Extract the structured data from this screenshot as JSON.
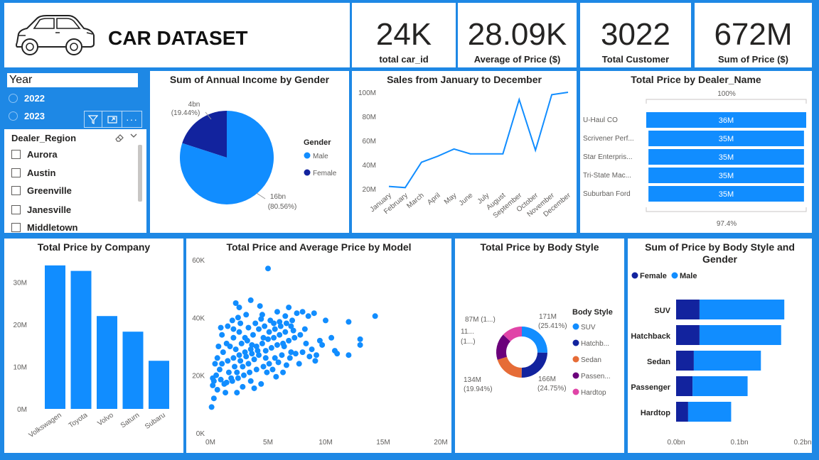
{
  "header": {
    "title": "CAR DATASET"
  },
  "kpis": [
    {
      "value": "24K",
      "label": "total car_id"
    },
    {
      "value": "28.09K",
      "label": "Average of Price ($)"
    },
    {
      "value": "3022",
      "label": "Total Customer"
    },
    {
      "value": "672M",
      "label": "Sum of Price ($)"
    }
  ],
  "year_slicer": {
    "title": "Year",
    "options": [
      "2022",
      "2023"
    ],
    "icons": [
      "filter-icon",
      "focus-mode-icon",
      "more-options-icon"
    ]
  },
  "region_slicer": {
    "title": "Dealer_Region",
    "options": [
      "Aurora",
      "Austin",
      "Greenville",
      "Janesville",
      "Middletown"
    ]
  },
  "colors": {
    "accent": "#118DFF",
    "dark": "#12239E",
    "orange": "#E66C37",
    "purple": "#6B007B",
    "pink": "#E044A7",
    "background": "#1E88E5"
  },
  "chart_data": [
    {
      "id": "gender_pie",
      "type": "pie",
      "title": "Sum of Annual Income by Gender",
      "legend_title": "Gender",
      "legend_position": "right",
      "slices": [
        {
          "name": "Male",
          "value": 16,
          "label": "16bn",
          "percent": "(80.56%)",
          "color": "#118DFF"
        },
        {
          "name": "Female",
          "value": 4,
          "label": "4bn",
          "percent": "(19.44%)",
          "color": "#12239E"
        }
      ]
    },
    {
      "id": "sales_line",
      "type": "line",
      "title": "Sales from January to December",
      "categories": [
        "January",
        "February",
        "March",
        "April",
        "May",
        "June",
        "July",
        "August",
        "September",
        "October",
        "November",
        "December"
      ],
      "values": [
        22,
        21,
        42,
        47,
        53,
        49,
        49,
        49,
        94,
        52,
        98,
        100
      ],
      "yticks": [
        "20M",
        "40M",
        "60M",
        "80M",
        "100M"
      ],
      "ylim": [
        20,
        100
      ]
    },
    {
      "id": "dealer_bar",
      "type": "bar",
      "orientation": "horizontal",
      "title": "Total Price by Dealer_Name",
      "top_label": "100%",
      "bottom_label": "97.4%",
      "categories": [
        "U-Haul CO",
        "Scrivener Perf...",
        "Star Enterpris...",
        "Tri-State Mac...",
        "Suburban Ford"
      ],
      "values": [
        36,
        35,
        35,
        35,
        35
      ],
      "labels": [
        "36M",
        "35M",
        "35M",
        "35M",
        "35M"
      ]
    },
    {
      "id": "company_bar",
      "type": "bar",
      "title": "Total Price by Company",
      "categories": [
        "Volkswagen",
        "Toyota",
        "Volvo",
        "Saturn",
        "Subaru"
      ],
      "values": [
        34,
        32.7,
        22,
        18.3,
        11.4
      ],
      "yticks": [
        "0M",
        "10M",
        "20M",
        "30M"
      ],
      "ylim": [
        0,
        36
      ]
    },
    {
      "id": "model_scatter",
      "type": "scatter",
      "title": "Total Price and Average Price by Model",
      "xticks": [
        "0M",
        "5M",
        "10M",
        "15M",
        "20M"
      ],
      "yticks": [
        "0K",
        "20K",
        "40K",
        "60K"
      ],
      "xlim": [
        0,
        20
      ],
      "ylim": [
        0,
        60
      ],
      "points": [
        [
          5,
          57
        ],
        [
          14.3,
          40.5
        ],
        [
          12,
          38.5
        ],
        [
          13,
          32.5
        ],
        [
          13,
          30.5
        ],
        [
          12,
          27
        ],
        [
          10.5,
          33
        ],
        [
          9.5,
          32
        ],
        [
          10.8,
          28.5
        ],
        [
          8.5,
          40.5
        ],
        [
          9,
          41.5
        ],
        [
          8,
          42
        ],
        [
          7.5,
          41.5
        ],
        [
          6.5,
          40.5
        ],
        [
          6,
          38.5
        ],
        [
          5.5,
          38
        ],
        [
          4.5,
          41
        ],
        [
          3.5,
          46
        ],
        [
          2.2,
          45
        ],
        [
          2.5,
          43.5
        ],
        [
          7,
          37
        ],
        [
          6.5,
          35
        ],
        [
          6,
          34
        ],
        [
          5.5,
          33
        ],
        [
          5,
          32.5
        ],
        [
          4.5,
          31
        ],
        [
          4,
          30
        ],
        [
          3.5,
          29
        ],
        [
          3,
          28
        ],
        [
          2.5,
          27
        ],
        [
          2,
          26
        ],
        [
          1.5,
          25
        ],
        [
          1,
          24
        ],
        [
          0.8,
          22
        ],
        [
          0.5,
          20
        ],
        [
          0.3,
          18
        ],
        [
          0.2,
          16.5
        ],
        [
          0.1,
          9
        ],
        [
          0.3,
          12
        ],
        [
          0.6,
          15
        ],
        [
          1.2,
          17
        ],
        [
          1.8,
          19
        ],
        [
          2.3,
          21
        ],
        [
          2.8,
          23
        ],
        [
          3.3,
          24
        ],
        [
          3.8,
          25.5
        ],
        [
          4.2,
          27
        ],
        [
          4.8,
          28.5
        ],
        [
          5.3,
          29.5
        ],
        [
          5.8,
          30.5
        ],
        [
          6.3,
          31
        ],
        [
          6.8,
          32
        ],
        [
          7.3,
          33
        ],
        [
          7.8,
          34
        ],
        [
          8.3,
          31
        ],
        [
          8.8,
          29
        ],
        [
          9.2,
          27
        ],
        [
          7,
          28
        ],
        [
          6.2,
          27
        ],
        [
          5.6,
          26
        ],
        [
          5.1,
          24
        ],
        [
          4.6,
          23
        ],
        [
          4,
          22
        ],
        [
          3.4,
          21
        ],
        [
          2.9,
          20
        ],
        [
          2.4,
          19
        ],
        [
          1.9,
          18
        ],
        [
          1.4,
          17.5
        ],
        [
          0.9,
          18.5
        ],
        [
          1.6,
          21
        ],
        [
          2.1,
          23
        ],
        [
          2.6,
          25
        ],
        [
          3.1,
          26.5
        ],
        [
          3.6,
          27.5
        ],
        [
          4.1,
          28.5
        ],
        [
          4.6,
          33
        ],
        [
          5.1,
          35
        ],
        [
          5.6,
          36
        ],
        [
          6.1,
          37
        ],
        [
          6.6,
          38
        ],
        [
          7.1,
          39
        ],
        [
          3,
          33
        ],
        [
          2.5,
          35
        ],
        [
          2,
          36
        ],
        [
          1.5,
          37
        ],
        [
          1,
          34
        ],
        [
          1.7,
          30
        ],
        [
          2.2,
          29
        ],
        [
          2.7,
          31
        ],
        [
          3.2,
          32
        ],
        [
          3.7,
          34
        ],
        [
          4.2,
          36
        ],
        [
          4.7,
          37
        ],
        [
          5.2,
          39
        ],
        [
          3.9,
          38
        ],
        [
          4.4,
          39.5
        ],
        [
          6.4,
          30
        ],
        [
          6.9,
          26
        ],
        [
          7.4,
          27.5
        ],
        [
          8,
          28
        ],
        [
          8.6,
          26.5
        ],
        [
          9.1,
          25
        ],
        [
          3.5,
          18
        ],
        [
          4.4,
          17
        ],
        [
          2.8,
          16
        ],
        [
          1.3,
          14
        ],
        [
          4.9,
          21
        ],
        [
          5.4,
          22
        ],
        [
          0.4,
          24
        ],
        [
          1.1,
          28
        ],
        [
          1.4,
          31
        ],
        [
          2,
          33
        ],
        [
          2.6,
          38
        ],
        [
          3.1,
          41
        ],
        [
          7.7,
          24
        ],
        [
          6.6,
          23.5
        ],
        [
          5.9,
          24.5
        ],
        [
          10,
          39
        ],
        [
          9.7,
          30.5
        ],
        [
          11,
          27.5
        ],
        [
          8.2,
          36
        ],
        [
          7.2,
          35.5
        ],
        [
          2.4,
          40
        ],
        [
          3.3,
          36.5
        ],
        [
          4.3,
          44
        ],
        [
          5.8,
          42
        ],
        [
          6.8,
          43.5
        ],
        [
          0.7,
          30
        ],
        [
          1.9,
          39
        ],
        [
          0.9,
          36.5
        ],
        [
          3.6,
          30.5
        ],
        [
          4.8,
          26
        ],
        [
          5.7,
          19.5
        ],
        [
          6.3,
          21
        ],
        [
          2.3,
          14
        ],
        [
          3.8,
          15.5
        ],
        [
          0.2,
          19
        ],
        [
          0.6,
          26
        ]
      ]
    },
    {
      "id": "body_donut",
      "type": "pie",
      "title": "Total Price by Body Style",
      "legend_title": "Body Style",
      "legend_position": "right",
      "slices": [
        {
          "name": "SUV",
          "legend": "SUV",
          "value": 25.41,
          "label": "171M",
          "percent": "(25.41%)",
          "color": "#118DFF"
        },
        {
          "name": "Hatchback",
          "legend": "Hatchb...",
          "value": 24.75,
          "label": "166M",
          "percent": "(24.75%)",
          "color": "#12239E"
        },
        {
          "name": "Sedan",
          "legend": "Sedan",
          "value": 19.94,
          "label": "134M",
          "percent": "(19.94%)",
          "color": "#E66C37"
        },
        {
          "name": "Passenger",
          "legend": "Passen...",
          "value": 16.9,
          "label": "11...",
          "percent": "(1...)",
          "color": "#6B007B"
        },
        {
          "name": "Hardtop",
          "legend": "Hardtop",
          "value": 13,
          "label": "87M (1...)",
          "percent": "",
          "color": "#E044A7"
        }
      ]
    },
    {
      "id": "body_gender_bar",
      "type": "bar",
      "orientation": "horizontal",
      "stacked": true,
      "title": "Sum of Price by Body Style and Gender",
      "legend_position": "top-left",
      "categories": [
        "SUV",
        "Hatchback",
        "Sedan",
        "Passenger",
        "Hardtop"
      ],
      "series": [
        {
          "name": "Female",
          "color": "#12239E",
          "values": [
            0.037,
            0.037,
            0.028,
            0.026,
            0.019
          ]
        },
        {
          "name": "Male",
          "color": "#118DFF",
          "values": [
            0.134,
            0.129,
            0.106,
            0.087,
            0.068
          ]
        }
      ],
      "xticks": [
        "0.0bn",
        "0.1bn",
        "0.2bn"
      ],
      "xlim": [
        0,
        0.2
      ]
    }
  ]
}
